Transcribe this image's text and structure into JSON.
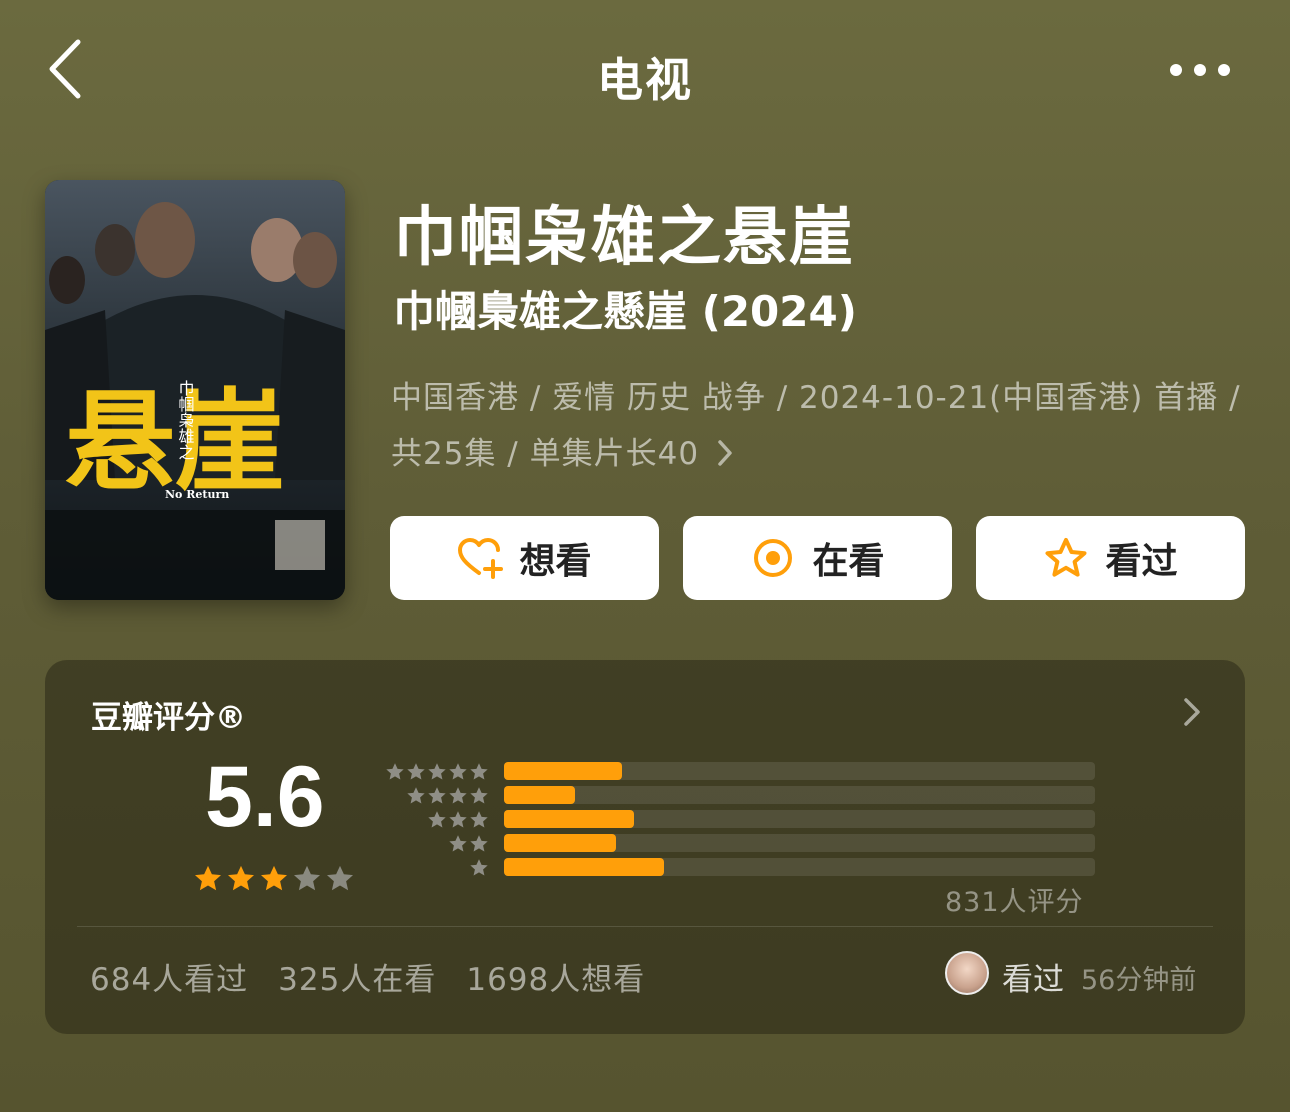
{
  "header": {
    "title": "电视"
  },
  "show": {
    "title_cn": "巾帼枭雄之悬崖",
    "title_original": "巾幗梟雄之懸崖 (2024)",
    "meta_line1": "中国香港 / 爱情 历史 战争 / 2024-10-21(中国香港) 首播 /",
    "meta_line2": "共25集 / 单集片长40",
    "poster": {
      "logo_text": "悬崖",
      "vertical_text": "巾帼枭雄之",
      "english_text": "No Return"
    }
  },
  "actions": {
    "want_label": "想看",
    "watching_label": "在看",
    "watched_label": "看过"
  },
  "rating": {
    "label": "豆瓣评分®",
    "score": "5.6",
    "stars_filled": 3,
    "stars_total": 5,
    "distribution": [
      {
        "stars": 5,
        "share": 0.2
      },
      {
        "stars": 4,
        "share": 0.12
      },
      {
        "stars": 3,
        "share": 0.22
      },
      {
        "stars": 2,
        "share": 0.19
      },
      {
        "stars": 1,
        "share": 0.27
      }
    ],
    "count_text": "831人评分",
    "stats": [
      "684人看过",
      "325人在看",
      "1698人想看"
    ],
    "my_status": "看过",
    "my_time": "56分钟前"
  },
  "colors": {
    "accent": "#ff9f0a",
    "background": "#635f39",
    "star_empty": "#8a8a80"
  }
}
